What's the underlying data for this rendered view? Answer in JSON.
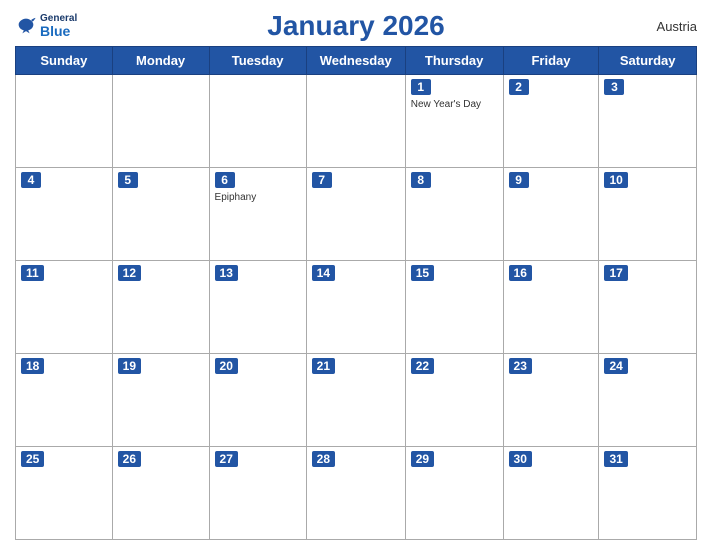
{
  "logo": {
    "general": "General",
    "blue": "Blue"
  },
  "header": {
    "title": "January 2026",
    "country": "Austria"
  },
  "weekdays": [
    "Sunday",
    "Monday",
    "Tuesday",
    "Wednesday",
    "Thursday",
    "Friday",
    "Saturday"
  ],
  "weeks": [
    [
      {
        "day": null
      },
      {
        "day": null
      },
      {
        "day": null
      },
      {
        "day": null
      },
      {
        "day": 1,
        "holiday": "New Year's Day"
      },
      {
        "day": 2
      },
      {
        "day": 3
      }
    ],
    [
      {
        "day": 4
      },
      {
        "day": 5
      },
      {
        "day": 6,
        "holiday": "Epiphany"
      },
      {
        "day": 7
      },
      {
        "day": 8
      },
      {
        "day": 9
      },
      {
        "day": 10
      }
    ],
    [
      {
        "day": 11
      },
      {
        "day": 12
      },
      {
        "day": 13
      },
      {
        "day": 14
      },
      {
        "day": 15
      },
      {
        "day": 16
      },
      {
        "day": 17
      }
    ],
    [
      {
        "day": 18
      },
      {
        "day": 19
      },
      {
        "day": 20
      },
      {
        "day": 21
      },
      {
        "day": 22
      },
      {
        "day": 23
      },
      {
        "day": 24
      }
    ],
    [
      {
        "day": 25
      },
      {
        "day": 26
      },
      {
        "day": 27
      },
      {
        "day": 28
      },
      {
        "day": 29
      },
      {
        "day": 30
      },
      {
        "day": 31
      }
    ]
  ]
}
